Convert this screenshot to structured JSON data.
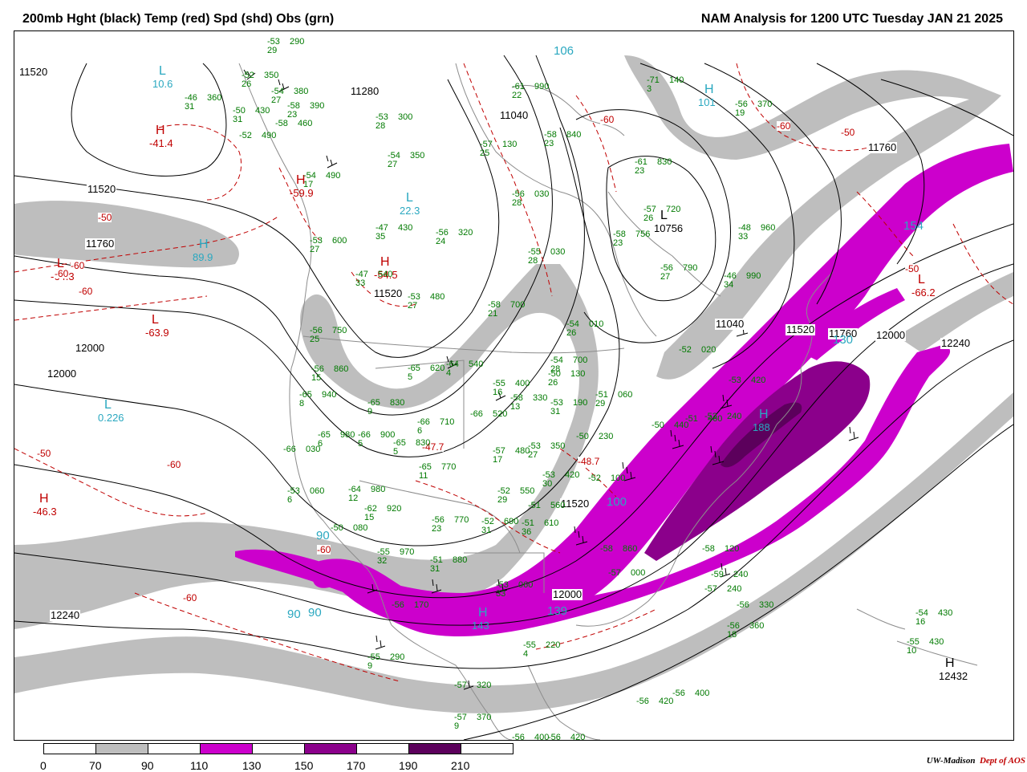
{
  "header": {
    "left_title": "200mb Hght (black) Temp (red) Spd (shd) Obs (grn)",
    "right_title": "NAM Analysis for 1200 UTC Tuesday  JAN 21 2025"
  },
  "colors": {
    "speed_70_90": "#bebebe",
    "speed_110_130": "#cc00cc",
    "speed_150_170": "#8b008b",
    "speed_190_210": "#5c005c",
    "height_contour": "#000000",
    "temperature": "#c00000",
    "observations": "#007a00",
    "center_labels": "#2aa8c0",
    "coastline": "#8c8c8c"
  },
  "legend": {
    "ticks": [
      "0",
      "70",
      "90",
      "110",
      "130",
      "150",
      "170",
      "190",
      "210"
    ]
  },
  "credit": {
    "org": "UW-Madison",
    "dept": "Dept of AOS"
  },
  "pressure_centers": [
    {
      "id": "c1",
      "letter": "L",
      "value": "10.6",
      "color": "cyan"
    },
    {
      "id": "c2",
      "letter": "H",
      "value": "-41.4",
      "color": "red"
    },
    {
      "id": "c3",
      "letter": "L",
      "value": "22.3",
      "color": "cyan"
    },
    {
      "id": "c4",
      "letter": "H",
      "value": "-59.9",
      "color": "red"
    },
    {
      "id": "c5",
      "letter": "H",
      "value": "89.9",
      "color": "cyan"
    },
    {
      "id": "c6",
      "letter": "L",
      "value": "-64.3",
      "color": "red"
    },
    {
      "id": "c7",
      "letter": "L",
      "value": "-63.9",
      "color": "red"
    },
    {
      "id": "c8",
      "letter": "L",
      "value": "0.226",
      "color": "cyan"
    },
    {
      "id": "c9",
      "letter": "H",
      "value": "-46.3",
      "color": "red"
    },
    {
      "id": "c10",
      "letter": "H",
      "value": "-54.5",
      "color": "red"
    },
    {
      "id": "c11",
      "letter": "L",
      "value": "10756",
      "color": "black"
    },
    {
      "id": "c12",
      "letter": "H",
      "value": "12432",
      "color": "black"
    },
    {
      "id": "c13",
      "letter": "H",
      "value": "188",
      "color": "cyan"
    },
    {
      "id": "c14",
      "letter": "H",
      "value": "143",
      "color": "cyan"
    },
    {
      "id": "c15",
      "letter": "H",
      "value": "101",
      "color": "cyan"
    },
    {
      "id": "c16",
      "letter": "L",
      "value": "-66.2",
      "color": "red"
    }
  ],
  "contour_labels": [
    "11520",
    "11280",
    "11040",
    "11760",
    "12000",
    "12240",
    "11520",
    "11760",
    "12000",
    "11520",
    "11040",
    "11520",
    "12240",
    "12000",
    "11760",
    "11520",
    "12000"
  ],
  "temperature_labels": [
    "-50",
    "-60",
    "-60",
    "-50",
    "-60",
    "-60",
    "-60",
    "-50",
    "-50",
    "-60",
    "-60",
    "-60",
    "-48.7",
    "-47.7"
  ],
  "speed_labels": [
    "106",
    "90",
    "90",
    "139",
    "130",
    "154",
    "100",
    "90"
  ],
  "stations": [
    {
      "t": "-53",
      "z": "290",
      "d": "29"
    },
    {
      "t": "-52",
      "z": "350",
      "d": "26"
    },
    {
      "t": "-46",
      "z": "360",
      "d": "31"
    },
    {
      "t": "-54",
      "z": "380",
      "d": "27"
    },
    {
      "t": "-58",
      "z": "390",
      "d": "23"
    },
    {
      "t": "-50",
      "z": "430",
      "d": "31"
    },
    {
      "t": "-58",
      "z": "460",
      "d": ""
    },
    {
      "t": "-52",
      "z": "490",
      "d": ""
    },
    {
      "t": "-53",
      "z": "300",
      "d": "28"
    },
    {
      "t": "-54",
      "z": "350",
      "d": "27"
    },
    {
      "t": "-61",
      "z": "990",
      "d": "22"
    },
    {
      "t": "-57",
      "z": "130",
      "d": "25"
    },
    {
      "t": "-58",
      "z": "840",
      "d": "23"
    },
    {
      "t": "-61",
      "z": "830",
      "d": "23"
    },
    {
      "t": "-71",
      "z": "140",
      "d": "3"
    },
    {
      "t": "-56",
      "z": "370",
      "d": "19"
    },
    {
      "t": "-56",
      "z": "030",
      "d": "28"
    },
    {
      "t": "-57",
      "z": "720",
      "d": "26"
    },
    {
      "t": "-58",
      "z": "756",
      "d": "23"
    },
    {
      "t": "-56",
      "z": "790",
      "d": "27"
    },
    {
      "t": "-48",
      "z": "960",
      "d": "33"
    },
    {
      "t": "-46",
      "z": "990",
      "d": "34"
    },
    {
      "t": "-54",
      "z": "490",
      "d": "17"
    },
    {
      "t": "-47",
      "z": "430",
      "d": "35"
    },
    {
      "t": "-56",
      "z": "320",
      "d": "24"
    },
    {
      "t": "-55",
      "z": "030",
      "d": "28"
    },
    {
      "t": "-53",
      "z": "600",
      "d": "27"
    },
    {
      "t": "-47",
      "z": "540",
      "d": "33"
    },
    {
      "t": "-53",
      "z": "480",
      "d": "27"
    },
    {
      "t": "-58",
      "z": "700",
      "d": "21"
    },
    {
      "t": "-54",
      "z": "010",
      "d": "26"
    },
    {
      "t": "-54",
      "z": "700",
      "d": "28"
    },
    {
      "t": "-56",
      "z": "750",
      "d": "25"
    },
    {
      "t": "-56",
      "z": "860",
      "d": "15"
    },
    {
      "t": "-65",
      "z": "620",
      "d": "5"
    },
    {
      "t": "-64",
      "z": "540",
      "d": "4"
    },
    {
      "t": "-50",
      "z": "130",
      "d": "26"
    },
    {
      "t": "-52",
      "z": "020",
      "d": ""
    },
    {
      "t": "-65",
      "z": "940",
      "d": "8"
    },
    {
      "t": "-65",
      "z": "830",
      "d": "9"
    },
    {
      "t": "-55",
      "z": "400",
      "d": "16"
    },
    {
      "t": "-58",
      "z": "330",
      "d": "13"
    },
    {
      "t": "-53",
      "z": "190",
      "d": "31"
    },
    {
      "t": "-51",
      "z": "060",
      "d": "29"
    },
    {
      "t": "-66",
      "z": "710",
      "d": "6"
    },
    {
      "t": "-66",
      "z": "520",
      "d": ""
    },
    {
      "t": "-65",
      "z": "980",
      "d": "6"
    },
    {
      "t": "-66",
      "z": "900",
      "d": "5"
    },
    {
      "t": "-65",
      "z": "830",
      "d": "5"
    },
    {
      "t": "-66",
      "z": "030",
      "d": ""
    },
    {
      "t": "-57",
      "z": "480",
      "d": "17"
    },
    {
      "t": "-53",
      "z": "350",
      "d": "27"
    },
    {
      "t": "-50",
      "z": "230",
      "d": ""
    },
    {
      "t": "-65",
      "z": "770",
      "d": "11"
    },
    {
      "t": "-53",
      "z": "060",
      "d": "6"
    },
    {
      "t": "-64",
      "z": "980",
      "d": "12"
    },
    {
      "t": "-62",
      "z": "920",
      "d": "15"
    },
    {
      "t": "-52",
      "z": "550",
      "d": "29"
    },
    {
      "t": "-53",
      "z": "420",
      "d": "30"
    },
    {
      "t": "-51",
      "z": "560",
      "d": ""
    },
    {
      "t": "-56",
      "z": "770",
      "d": "23"
    },
    {
      "t": "-52",
      "z": "690",
      "d": "31"
    },
    {
      "t": "-51",
      "z": "610",
      "d": "36"
    },
    {
      "t": "-50",
      "z": "080",
      "d": ""
    },
    {
      "t": "-55",
      "z": "970",
      "d": "32"
    },
    {
      "t": "-51",
      "z": "880",
      "d": "31"
    },
    {
      "t": "-58",
      "z": "860",
      "d": ""
    },
    {
      "t": "-57",
      "z": "000",
      "d": ""
    },
    {
      "t": "-53",
      "z": "060",
      "d": "33"
    },
    {
      "t": "-58",
      "z": "120",
      "d": ""
    },
    {
      "t": "-59",
      "z": "240",
      "d": ""
    },
    {
      "t": "-57",
      "z": "240",
      "d": ""
    },
    {
      "t": "-56",
      "z": "330",
      "d": ""
    },
    {
      "t": "-56",
      "z": "360",
      "d": "18"
    },
    {
      "t": "-54",
      "z": "430",
      "d": "16"
    },
    {
      "t": "-55",
      "z": "430",
      "d": "10"
    },
    {
      "t": "-53",
      "z": "240",
      "d": ""
    },
    {
      "t": "-55",
      "z": "220",
      "d": "4"
    },
    {
      "t": "-56",
      "z": "170",
      "d": ""
    },
    {
      "t": "-55",
      "z": "290",
      "d": "9"
    },
    {
      "t": "-57",
      "z": "320",
      "d": ""
    },
    {
      "t": "-57",
      "z": "370",
      "d": "9"
    },
    {
      "t": "-56",
      "z": "400",
      "d": ""
    },
    {
      "t": "-56",
      "z": "420",
      "d": ""
    },
    {
      "t": "-56",
      "z": "400",
      "d": ""
    },
    {
      "t": "-56",
      "z": "420",
      "d": ""
    },
    {
      "t": "-51",
      "z": "460",
      "d": ""
    },
    {
      "t": "-53",
      "z": "420",
      "d": ""
    },
    {
      "t": "-50",
      "z": "440",
      "d": ""
    },
    {
      "t": "-52",
      "z": "100",
      "d": ""
    }
  ]
}
